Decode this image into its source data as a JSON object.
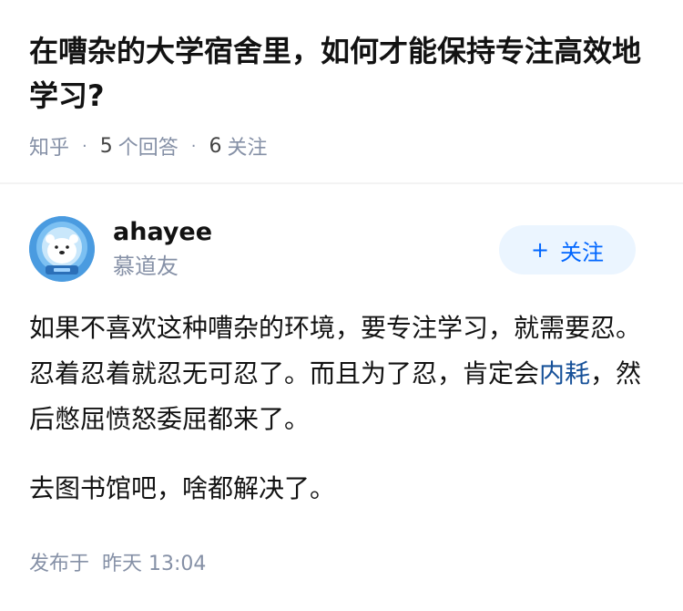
{
  "question": {
    "title": "在嘈杂的大学宿舍里，如何才能保持专注高效地学习?",
    "source": "知乎",
    "answers_count": "5",
    "answers_label": "个回答",
    "followers_count": "6",
    "followers_label": "关注"
  },
  "answer": {
    "author_name": "ahayee",
    "author_badge": "慕道友",
    "follow_plus": "+",
    "follow_label": "关注",
    "paragraph1_before": "如果不喜欢这种嘈杂的环境，要专注学习，就需要忍。忍着忍着就忍无可忍了。而且为了忍，肯定会",
    "paragraph1_link": "内耗",
    "paragraph1_after": "，然后憋屈愤怒委屈都来了。",
    "paragraph2": "去图书馆吧，啥都解决了。",
    "published_label": "发布于",
    "published_time": "昨天 13:04"
  },
  "icons": {
    "avatar": "polar-bear-astronaut-avatar"
  },
  "colors": {
    "meta_gray": "#8590a6",
    "link_blue": "#175199",
    "follow_blue": "#0066ff",
    "follow_bg": "#ebf5ff"
  }
}
